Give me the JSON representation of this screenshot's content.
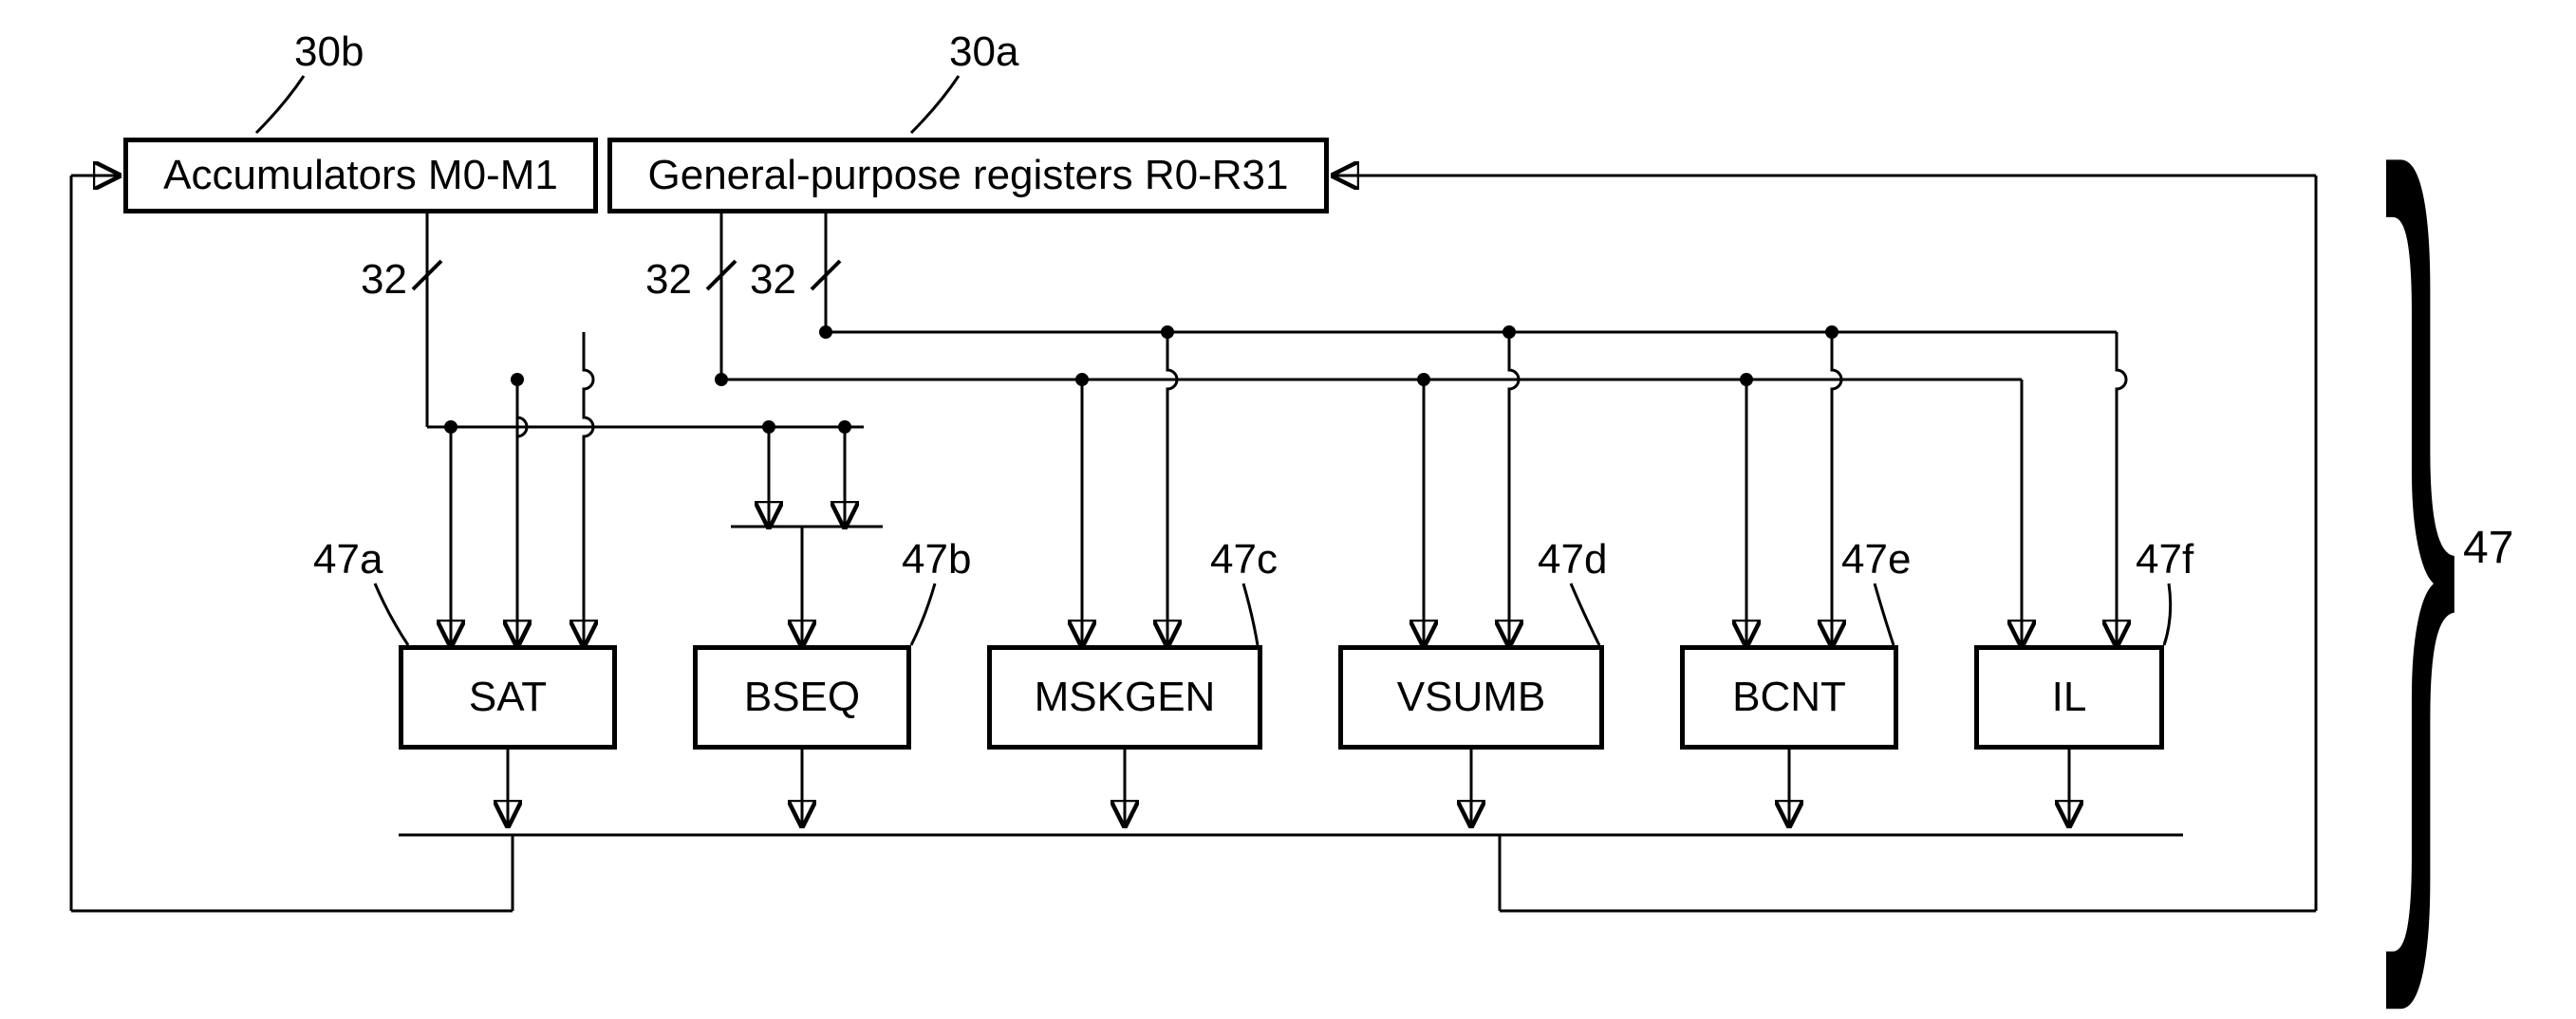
{
  "labels": {
    "ref_accumulators": "30b",
    "ref_gpr": "30a",
    "bus_width_1": "32",
    "bus_width_2": "32",
    "bus_width_3": "32",
    "ref_sat": "47a",
    "ref_bseq": "47b",
    "ref_mskgen": "47c",
    "ref_vsumb": "47d",
    "ref_bcnt": "47e",
    "ref_il": "47f",
    "ref_group": "47"
  },
  "blocks": {
    "accumulators": "Accumulators M0-M1",
    "gpr": "General-purpose registers R0-R31",
    "sat": "SAT",
    "bseq": "BSEQ",
    "mskgen": "MSKGEN",
    "vsumb": "VSUMB",
    "bcnt": "BCNT",
    "il": "IL"
  },
  "chart_data": {
    "type": "diagram",
    "nodes": [
      {
        "id": "30b",
        "label": "Accumulators M0-M1"
      },
      {
        "id": "30a",
        "label": "General-purpose registers R0-R31"
      },
      {
        "id": "47a",
        "label": "SAT"
      },
      {
        "id": "47b",
        "label": "BSEQ"
      },
      {
        "id": "47c",
        "label": "MSKGEN"
      },
      {
        "id": "47d",
        "label": "VSUMB"
      },
      {
        "id": "47e",
        "label": "BCNT"
      },
      {
        "id": "47f",
        "label": "IL"
      }
    ],
    "bus_widths": [
      32,
      32,
      32
    ],
    "group": {
      "id": "47",
      "members": [
        "47a",
        "47b",
        "47c",
        "47d",
        "47e",
        "47f"
      ]
    },
    "edges": [
      {
        "from": "30b",
        "to": "47a",
        "width": 32
      },
      {
        "from": "30a",
        "to": "47a",
        "width": 32
      },
      {
        "from": "30a",
        "to": "47b",
        "width": 32
      },
      {
        "from": "30a",
        "to": "47c",
        "width": 32
      },
      {
        "from": "30a",
        "to": "47d",
        "width": 32
      },
      {
        "from": "30a",
        "to": "47e",
        "width": 32
      },
      {
        "from": "30a",
        "to": "47f",
        "width": 32
      },
      {
        "from": "47a",
        "to": "bus"
      },
      {
        "from": "47b",
        "to": "bus"
      },
      {
        "from": "47c",
        "to": "bus"
      },
      {
        "from": "47d",
        "to": "bus"
      },
      {
        "from": "47e",
        "to": "bus"
      },
      {
        "from": "47f",
        "to": "bus"
      },
      {
        "from": "bus",
        "to": "30b"
      },
      {
        "from": "bus",
        "to": "30a"
      }
    ]
  }
}
